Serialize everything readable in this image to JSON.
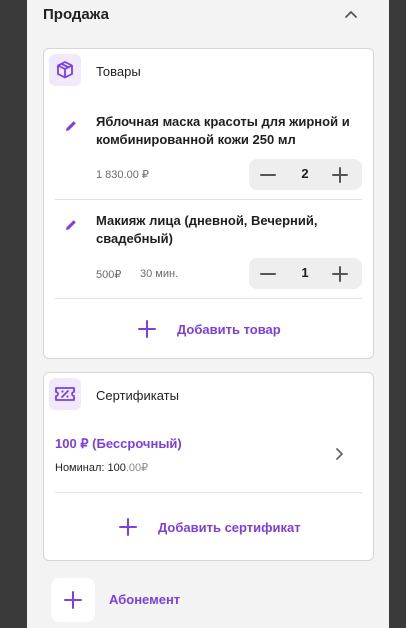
{
  "section": {
    "title": "Продажа"
  },
  "colors": {
    "accent": "#7b3fe4",
    "icon_bg": "#efe9fb"
  },
  "products": {
    "title": "Товары",
    "icon": "package-icon",
    "items": [
      {
        "name": "Яблочная маска красоты для жирной и комбинированной кожи 250 мл",
        "price": "1 830.00 ₽",
        "duration": "",
        "quantity": "2"
      },
      {
        "name": "Макияж лица (дневной, Вечерний, свадебный)",
        "price": "500₽",
        "duration": "30 мин.",
        "quantity": "1"
      }
    ],
    "add_label": "Добавить товар"
  },
  "certificates": {
    "title": "Сертификаты",
    "icon": "ticket-percent-icon",
    "item": {
      "name": "100 ₽ (Бессрочный)",
      "nominal_label": "Номинал:",
      "nominal_value_main": "100",
      "nominal_value_dim": ".00₽"
    },
    "add_label": "Добавить сертификат"
  },
  "subscription": {
    "label": "Абонемент"
  }
}
